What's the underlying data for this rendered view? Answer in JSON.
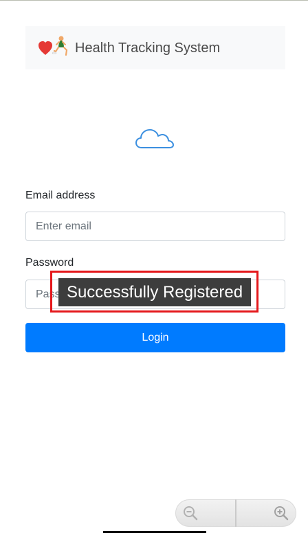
{
  "app": {
    "brand_title": "Health Tracking System",
    "brand_icon": "heart-runner-icon"
  },
  "header_icon": "cloud-icon",
  "form": {
    "email_label": "Email address",
    "email_value": "",
    "email_placeholder": "Enter email",
    "password_label": "Password",
    "password_value": "",
    "password_placeholder": "Password",
    "login_label": "Login"
  },
  "toast": {
    "message": "Successfully Registered"
  },
  "zoom": {
    "zoom_out_icon": "zoom-out-icon",
    "zoom_in_icon": "zoom-in-icon"
  },
  "colors": {
    "primary": "#007bff",
    "navbar_bg": "#f8f9fa",
    "toast_bg": "#3d3d3d",
    "highlight": "#e4171b"
  }
}
